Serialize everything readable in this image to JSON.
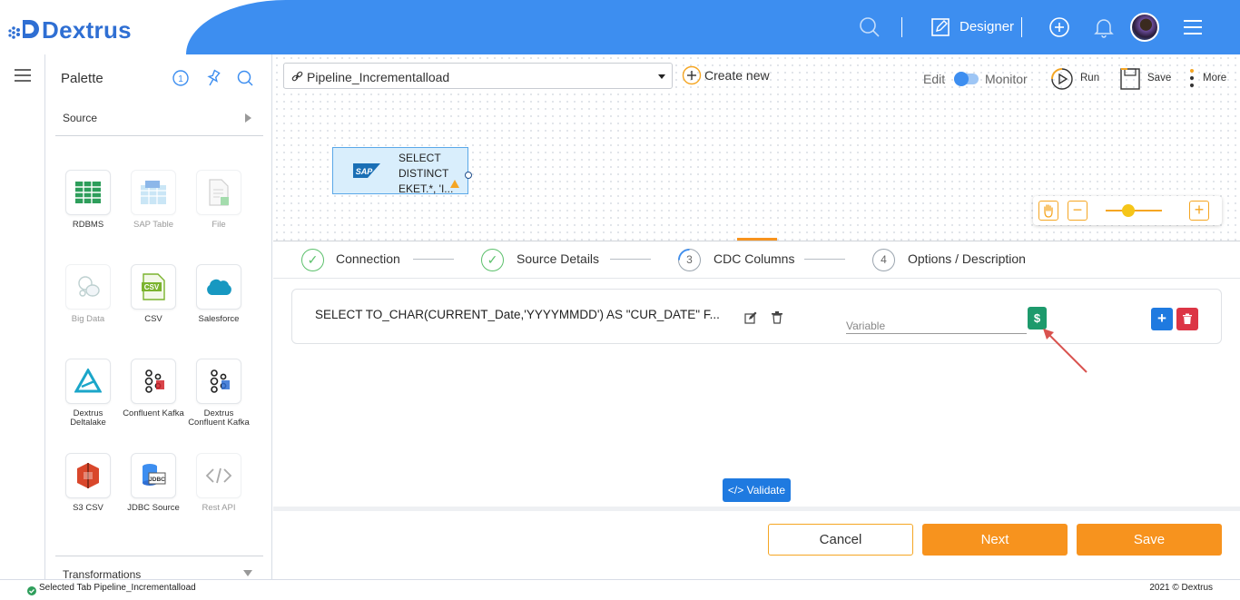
{
  "header": {
    "brand": "Dextrus",
    "designer_label": "Designer",
    "icons": [
      "search-icon",
      "edit-icon",
      "plus-circle-icon",
      "bell-icon",
      "avatar",
      "hamburger-icon"
    ]
  },
  "palette": {
    "title": "Palette",
    "source_label": "Source",
    "transformations_label": "Transformations",
    "tiles": [
      {
        "label": "RDBMS",
        "enabled": true
      },
      {
        "label": "SAP Table",
        "enabled": false
      },
      {
        "label": "File",
        "enabled": false
      },
      {
        "label": "Big Data",
        "enabled": false
      },
      {
        "label": "CSV",
        "enabled": true
      },
      {
        "label": "Salesforce",
        "enabled": true
      },
      {
        "label": "Dextrus Deltalake",
        "enabled": true
      },
      {
        "label": "Confluent Kafka",
        "enabled": true
      },
      {
        "label": "Dextrus Confluent Kafka",
        "enabled": true
      },
      {
        "label": "S3 CSV",
        "enabled": true
      },
      {
        "label": "JDBC Source",
        "enabled": true
      },
      {
        "label": "Rest API",
        "enabled": false
      }
    ]
  },
  "toolbar": {
    "pipeline_name": "Pipeline_Incrementalload",
    "create_new": "Create new",
    "edit": "Edit",
    "monitor": "Monitor",
    "run": "Run",
    "save": "Save",
    "more": "More"
  },
  "node": {
    "line1": "SELECT",
    "line2": "DISTINCT",
    "line3": "EKET.*, 'I..."
  },
  "zoom": {
    "level": 0.4
  },
  "steps": [
    {
      "label": "Connection",
      "state": "done"
    },
    {
      "label": "Source Details",
      "state": "done"
    },
    {
      "label": "CDC Columns",
      "state": "current",
      "num": "3"
    },
    {
      "label": "Options / Description",
      "state": "todo",
      "num": "4"
    }
  ],
  "cdc": {
    "sql": "SELECT TO_CHAR(CURRENT_Date,'YYYYMMDD') AS \"CUR_DATE\" F...",
    "variable_placeholder": "Variable",
    "dollar": "$",
    "plus": "+"
  },
  "buttons": {
    "validate": "Validate",
    "cancel": "Cancel",
    "next": "Next",
    "save": "Save"
  },
  "status": {
    "text": "Selected Tab Pipeline_Incrementalload",
    "copyright": "2021 © Dextrus"
  },
  "colors": {
    "header_blue": "#3d8ef0",
    "orange": "#f7931e",
    "green": "#1d9a6c",
    "primary": "#1f7ae0",
    "danger": "#dc3545"
  }
}
